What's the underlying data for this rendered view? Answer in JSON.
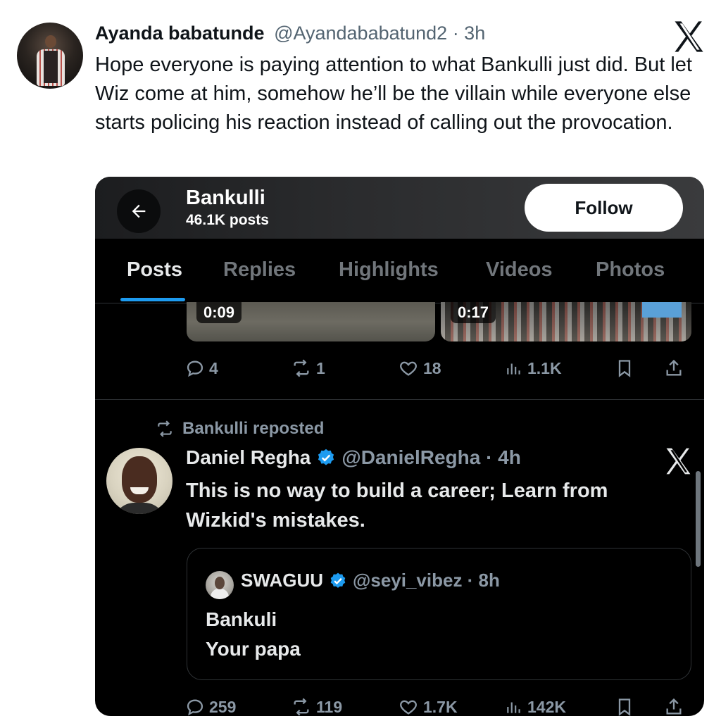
{
  "outer_tweet": {
    "author_name": "Ayanda babatunde",
    "author_handle": "@Ayandababatund2 · 3h",
    "text": "Hope everyone is paying attention to what Bankulli just did. But let Wiz come at him, somehow he’ll be the villain while everyone else starts policing his reaction instead of calling out the provocation.",
    "logo_icon": "x-logo-icon"
  },
  "profile": {
    "name": "Bankulli",
    "posts_count": "46.1K posts",
    "follow_label": "Follow"
  },
  "tabs": [
    "Posts",
    "Replies",
    "Highlights",
    "Videos",
    "Photos"
  ],
  "active_tab": "Posts",
  "media": {
    "video1_duration": "0:09",
    "video2_duration": "0:17"
  },
  "first_post_stats": {
    "replies": "4",
    "reposts": "1",
    "likes": "18",
    "views": "1.1K"
  },
  "repost_label": "Bankulli reposted",
  "reposted_tweet": {
    "author_name": "Daniel Regha",
    "author_handle": "@DanielRegha · 4h",
    "text": "This is no way to build a career; Learn from Wizkid's mistakes.",
    "verified": true
  },
  "quoted_tweet": {
    "author_name": "SWAGUU",
    "author_handle": "@seyi_vibez · 8h",
    "line1": "Bankuli",
    "line2": "Your papa",
    "verified": true
  },
  "second_post_stats": {
    "replies": "259",
    "reposts": "119",
    "likes": "1.7K",
    "views": "142K"
  },
  "colors": {
    "accent_blue": "#1d9bf0",
    "muted_text": "#8b98a5",
    "dark_bg": "#000000"
  }
}
